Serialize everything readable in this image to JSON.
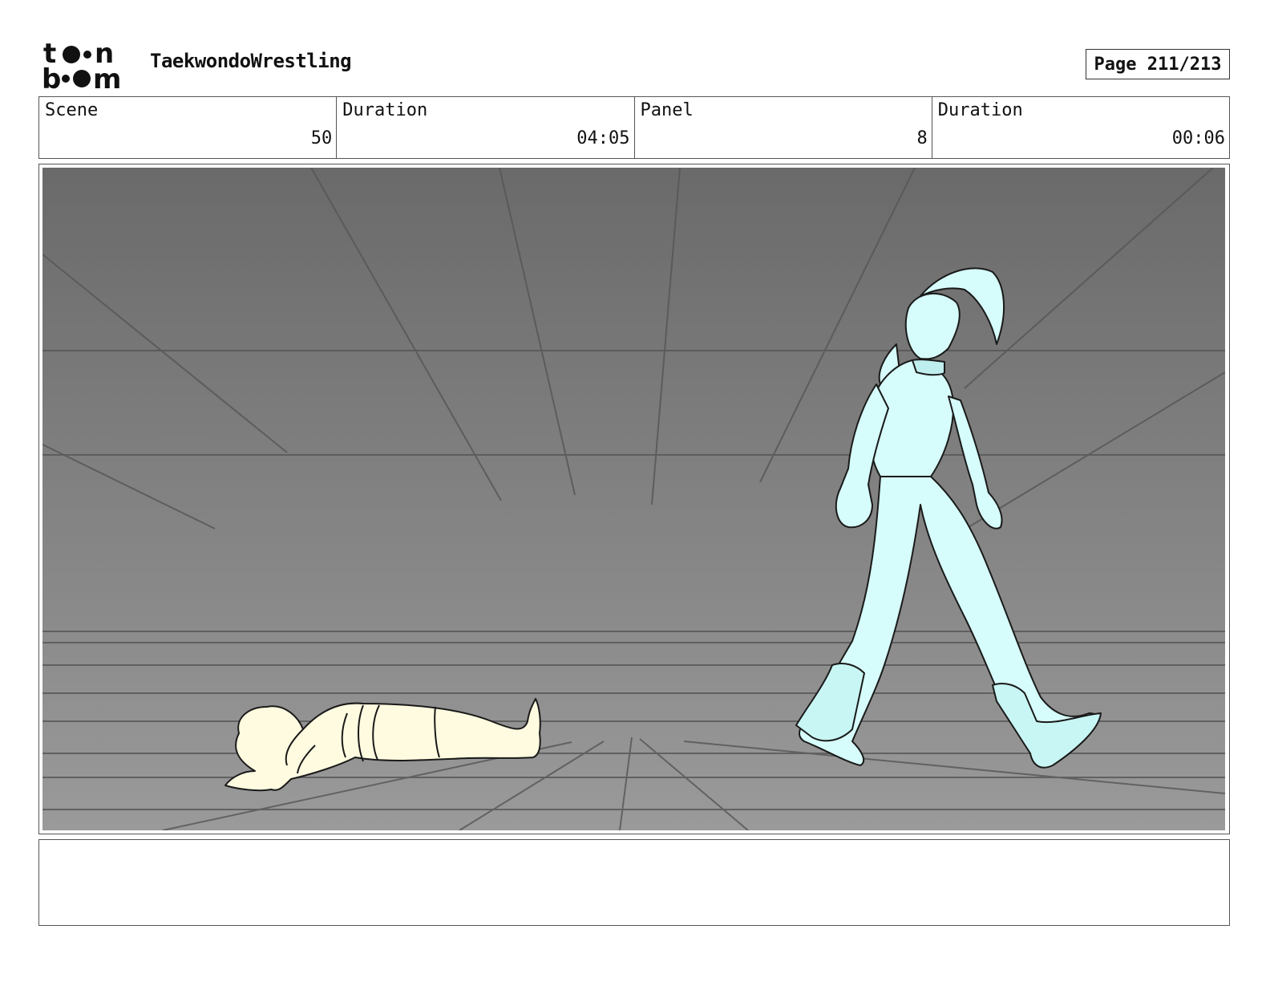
{
  "header": {
    "logo_alt": "toon boom",
    "project_title": "TaekwondoWrestling",
    "page_label": "Page 211/213"
  },
  "info": {
    "scene_label": "Scene",
    "scene_value": "50",
    "scene_duration_label": "Duration",
    "scene_duration_value": "04:05",
    "panel_label": "Panel",
    "panel_value": "8",
    "panel_duration_label": "Duration",
    "panel_duration_value": "00:06"
  },
  "colors": {
    "fallen_fighter_fill": "#fffbe0",
    "standing_fighter_fill": "#d6fdfb",
    "background_top": "#6a6a6a",
    "background_bottom": "#9a9a9a"
  },
  "notes": {
    "text": ""
  }
}
